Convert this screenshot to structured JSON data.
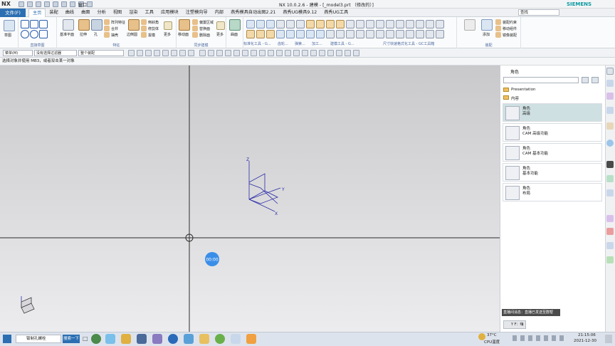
{
  "titlebar": {
    "logo": "NX",
    "window_menu": "窗口",
    "title": "NX 10.0.2.6 - 建模 - [_model3.prt （修改的）]",
    "brand": "SIEMENS"
  },
  "menubar": {
    "file": "文件(F)",
    "tabs": [
      "主页",
      "装配",
      "曲线",
      "曲面",
      "分析",
      "视图",
      "渲染",
      "工具",
      "应用模块",
      "注塑模向导",
      "内部",
      "燕秀模具自动出图2.21",
      "燕秀UG模具9.12",
      "燕秀UG工具"
    ],
    "active_index": 0,
    "search_placeholder": "查找"
  },
  "ribbon": {
    "groups": [
      "直接草图",
      "特征",
      "同步建模",
      "",
      "标准化工具 - G...",
      "齿轮...",
      "弹簧...",
      "加工...",
      "建模工具 - G...",
      "尺寸快速格式化工具 - GC工具箱",
      "",
      "",
      "装配"
    ],
    "labels": {
      "sketch": "草图",
      "datum_plane": "基准平面",
      "extrude": "拉伸",
      "hole": "孔",
      "pattern_feature": "阵列特征",
      "unite": "合并",
      "shell": "抽壳",
      "edge_blend": "边倒圆",
      "chamfer": "倒斜角",
      "draft": "拔模",
      "trim_body": "修剪体",
      "more": "更多",
      "move_face": "移动面",
      "offset_region": "偏置区域",
      "replace_face": "替换面",
      "delete_face": "删除面",
      "more2": "更多",
      "surface": "曲面",
      "add": "添加",
      "assembly_constraint": "装配约束",
      "move_component": "移动组件",
      "mirror_assembly": "镜像装配",
      "create_assembly": "合并装配"
    }
  },
  "toolbar2": {
    "menu_button": "菜单(M)",
    "filter": "没有选择过滤器",
    "scope": "整个装配"
  },
  "status_message": "选择对象并使用 MB3，或者双击某一对象",
  "viewport": {
    "axis_labels": {
      "z": "Z",
      "y": "Y",
      "x": "X"
    },
    "recording_badge": "00:00"
  },
  "role_panel": {
    "header": "角色",
    "folders": [
      "Presentation",
      "内容"
    ],
    "roles": [
      {
        "title": "角色",
        "subtitle": "高级"
      },
      {
        "title": "角色",
        "subtitle": "CAM 高级功能"
      },
      {
        "title": "角色",
        "subtitle": "CAM 基本功能"
      },
      {
        "title": "角色",
        "subtitle": "基本功能"
      },
      {
        "title": "角色",
        "subtitle": "布局"
      }
    ],
    "tooltip": "直播间消息：直播已发送至群帮",
    "chat_pill": "Y F：嗨"
  },
  "taskbar": {
    "search_text": "钣制孔螺栓",
    "search_button": "搜索一下",
    "weather_temp": "37°C",
    "weather_label": "CPU温度",
    "time": "21:15:06",
    "date": "2021-12-30"
  },
  "colors": {
    "accent": "#2b6fb2",
    "brand": "#0a9aa0",
    "selected_role": "#cfe0e2",
    "viewport_top": "#c9c9cb",
    "viewport_bottom": "#ececee",
    "axis": "#2a2aa8",
    "record_badge": "#3b8ee8"
  }
}
